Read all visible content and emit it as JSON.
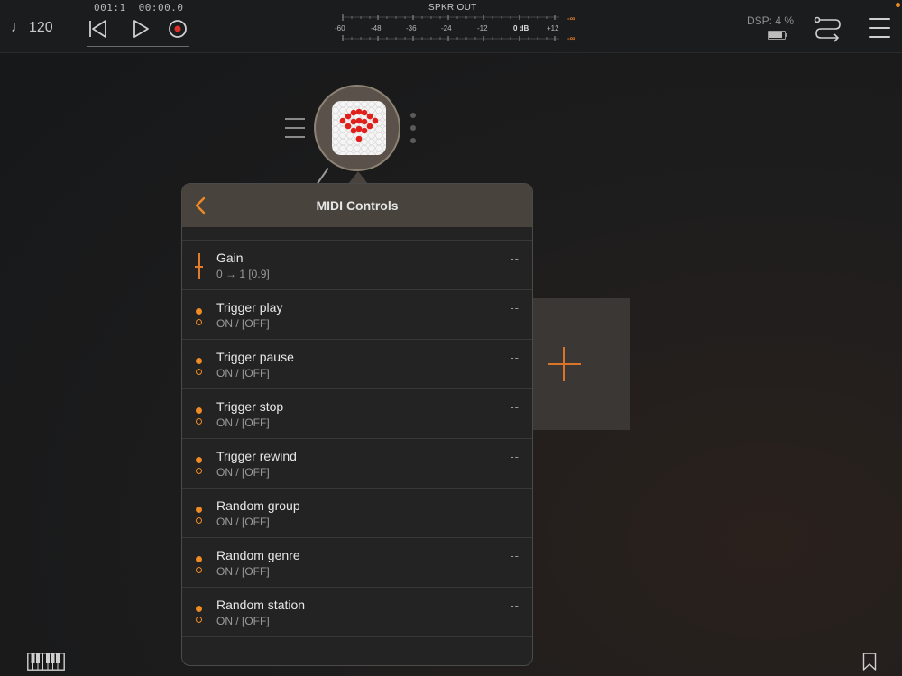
{
  "topbar": {
    "tempo": "120",
    "tempo_icon": "quarter-note-icon",
    "position": "001:1",
    "time": "00:00.0",
    "meter_label": "SPKR OUT",
    "meter_scale": [
      "-60",
      "-48",
      "-36",
      "-24",
      "-12",
      "0 dB",
      "+12"
    ],
    "meter_peak_top": "-∞",
    "meter_peak_bottom": "-∞",
    "dsp": "DSP:  4 %",
    "accent_color": "#f08a24"
  },
  "panel": {
    "title": "MIDI Controls",
    "controls": [
      {
        "name": "Gain",
        "value": "0 → 1  [0.9]",
        "mapping": "--",
        "type": "fader"
      },
      {
        "name": "Trigger play",
        "value": "ON / [OFF]",
        "mapping": "--",
        "type": "toggle"
      },
      {
        "name": "Trigger pause",
        "value": "ON / [OFF]",
        "mapping": "--",
        "type": "toggle"
      },
      {
        "name": "Trigger stop",
        "value": "ON / [OFF]",
        "mapping": "--",
        "type": "toggle"
      },
      {
        "name": "Trigger rewind",
        "value": "ON / [OFF]",
        "mapping": "--",
        "type": "toggle"
      },
      {
        "name": "Random group",
        "value": "ON / [OFF]",
        "mapping": "--",
        "type": "toggle"
      },
      {
        "name": "Random genre",
        "value": "ON / [OFF]",
        "mapping": "--",
        "type": "toggle"
      },
      {
        "name": "Random station",
        "value": "ON / [OFF]",
        "mapping": "--",
        "type": "toggle"
      }
    ]
  }
}
